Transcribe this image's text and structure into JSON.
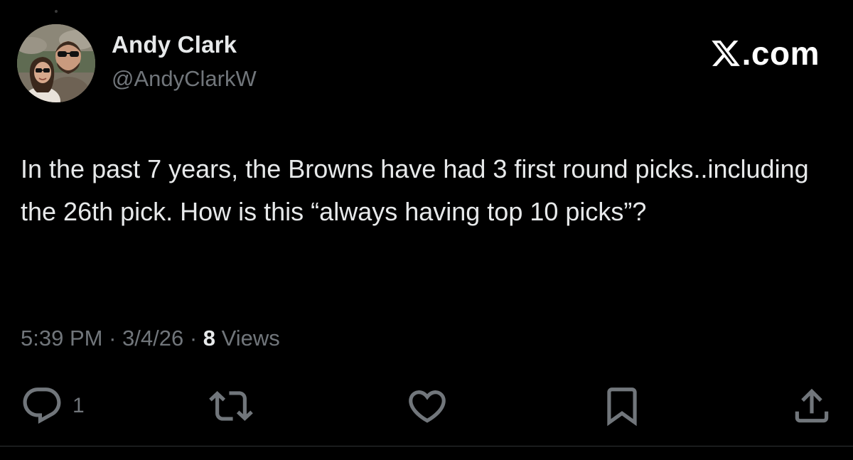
{
  "author": {
    "display_name": "Andy Clark",
    "handle": "@AndyClarkW"
  },
  "brand": {
    "logo_icon": "x-logo-icon",
    "suffix": ".com"
  },
  "tweet": {
    "text": "In the past 7 years, the Browns have had 3 first round picks..including the 26th pick. How is this “always having top 10 picks”?",
    "time": "5:39 PM",
    "date": "3/4/26",
    "views_count": "8",
    "views_label": "Views"
  },
  "actions": {
    "reply_icon": "reply-icon",
    "reply_count": "1",
    "retweet_icon": "retweet-icon",
    "like_icon": "heart-icon",
    "bookmark_icon": "bookmark-icon",
    "share_icon": "share-icon"
  },
  "colors": {
    "background": "#000000",
    "primary_text": "#e7e9ea",
    "secondary_text": "#71767b",
    "divider": "#2f3336"
  }
}
